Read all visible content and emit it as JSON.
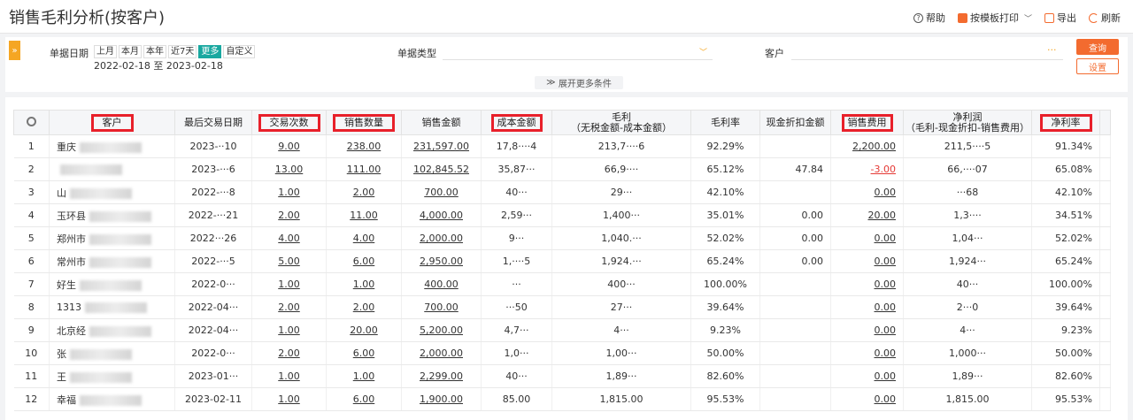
{
  "app": {
    "title": "销售毛利分析(按客户)"
  },
  "toolbar": {
    "help": "帮助",
    "print": "按模板打印",
    "export": "导出",
    "refresh": "刷新"
  },
  "filters": {
    "date_label": "单据日期",
    "quick_dates": [
      "上月",
      "本月",
      "本年",
      "近7天",
      "更多",
      "自定义"
    ],
    "date_range": "2022-02-18 至 2023-02-18",
    "doc_type_label": "单据类型",
    "customer_label": "客户",
    "customer_more": "···",
    "query_button": "查询",
    "settings_button": "设置",
    "expand_more": "展开更多条件"
  },
  "table": {
    "headers": {
      "customer": "客户",
      "last_date": "最后交易日期",
      "trades": "交易次数",
      "qty": "销售数量",
      "amount": "销售金额",
      "cost": "成本金额",
      "gross_profit": "毛利",
      "gross_profit_sub": "（无税金额-成本金额）",
      "gross_rate": "毛利率",
      "discount": "现金折扣金额",
      "sales_expense": "销售费用",
      "net_profit": "净利润",
      "net_profit_sub": "（毛利-现金折扣-销售费用）",
      "net_rate": "净利率"
    },
    "rows": [
      {
        "idx": "1",
        "customer": "重庆",
        "date": "2023-··10",
        "trades": "9.00",
        "qty": "238.00",
        "amount": "231,597.00",
        "cost": "17,8····4",
        "gp": "213,7····6",
        "gpr": "92.29%",
        "disc": "",
        "exp": "2,200.00",
        "np": "211,5····5",
        "npr": "91.34%"
      },
      {
        "idx": "2",
        "customer": "",
        "date": "2023-···6",
        "trades": "13.00",
        "qty": "111.00",
        "amount": "102,845.52",
        "cost": "35,87···",
        "gp": "66,9····",
        "gpr": "65.12%",
        "disc": "47.84",
        "exp": "-3.00",
        "np": "66,····07",
        "npr": "65.08%"
      },
      {
        "idx": "3",
        "customer": "山",
        "date": "2022-···8",
        "trades": "1.00",
        "qty": "2.00",
        "amount": "700.00",
        "cost": "40···",
        "gp": "29···",
        "gpr": "42.10%",
        "disc": "",
        "exp": "0.00",
        "np": "···68",
        "npr": "42.10%"
      },
      {
        "idx": "4",
        "customer": "玉环县",
        "date": "2022-···21",
        "trades": "2.00",
        "qty": "11.00",
        "amount": "4,000.00",
        "cost": "2,59···",
        "gp": "1,400···",
        "gpr": "35.01%",
        "disc": "0.00",
        "exp": "20.00",
        "np": "1,3····",
        "npr": "34.51%"
      },
      {
        "idx": "5",
        "customer": "郑州市",
        "date": "2022···26",
        "trades": "4.00",
        "qty": "4.00",
        "amount": "2,000.00",
        "cost": "9···",
        "gp": "1,040.···",
        "gpr": "52.02%",
        "disc": "0.00",
        "exp": "0.00",
        "np": "1,04···",
        "npr": "52.02%"
      },
      {
        "idx": "6",
        "customer": "常州市",
        "date": "2022-···5",
        "trades": "5.00",
        "qty": "6.00",
        "amount": "2,950.00",
        "cost": "1,····5",
        "gp": "1,924.···",
        "gpr": "65.24%",
        "disc": "0.00",
        "exp": "0.00",
        "np": "1,924···",
        "npr": "65.24%"
      },
      {
        "idx": "7",
        "customer": "好生",
        "date": "2022-0···",
        "trades": "1.00",
        "qty": "1.00",
        "amount": "400.00",
        "cost": "···",
        "gp": "400···",
        "gpr": "100.00%",
        "disc": "",
        "exp": "0.00",
        "np": "40···",
        "npr": "100.00%"
      },
      {
        "idx": "8",
        "customer": "1313",
        "date": "2022-04···",
        "trades": "2.00",
        "qty": "2.00",
        "amount": "700.00",
        "cost": "···50",
        "gp": "27···",
        "gpr": "39.64%",
        "disc": "",
        "exp": "0.00",
        "np": "2···0",
        "npr": "39.64%"
      },
      {
        "idx": "9",
        "customer": "北京经",
        "date": "2022-04···",
        "trades": "1.00",
        "qty": "20.00",
        "amount": "5,200.00",
        "cost": "4,7···",
        "gp": "4···",
        "gpr": "9.23%",
        "disc": "",
        "exp": "0.00",
        "np": "4···",
        "npr": "9.23%"
      },
      {
        "idx": "10",
        "customer": "张",
        "date": "2022-0···",
        "trades": "2.00",
        "qty": "6.00",
        "amount": "2,000.00",
        "cost": "1,0···",
        "gp": "1,00···",
        "gpr": "50.00%",
        "disc": "",
        "exp": "0.00",
        "np": "1,000···",
        "npr": "50.00%"
      },
      {
        "idx": "11",
        "customer": "王",
        "date": "2023-01···",
        "trades": "1.00",
        "qty": "1.00",
        "amount": "2,299.00",
        "cost": "40···",
        "gp": "1,89···",
        "gpr": "82.60%",
        "disc": "",
        "exp": "0.00",
        "np": "1,89···",
        "npr": "82.60%"
      },
      {
        "idx": "12",
        "customer": "幸福",
        "date": "2023-02-11",
        "trades": "1.00",
        "qty": "6.00",
        "amount": "1,900.00",
        "cost": "85.00",
        "gp": "1,815.00",
        "gpr": "95.53%",
        "disc": "",
        "exp": "0.00",
        "np": "1,815.00",
        "npr": "95.53%"
      }
    ]
  }
}
